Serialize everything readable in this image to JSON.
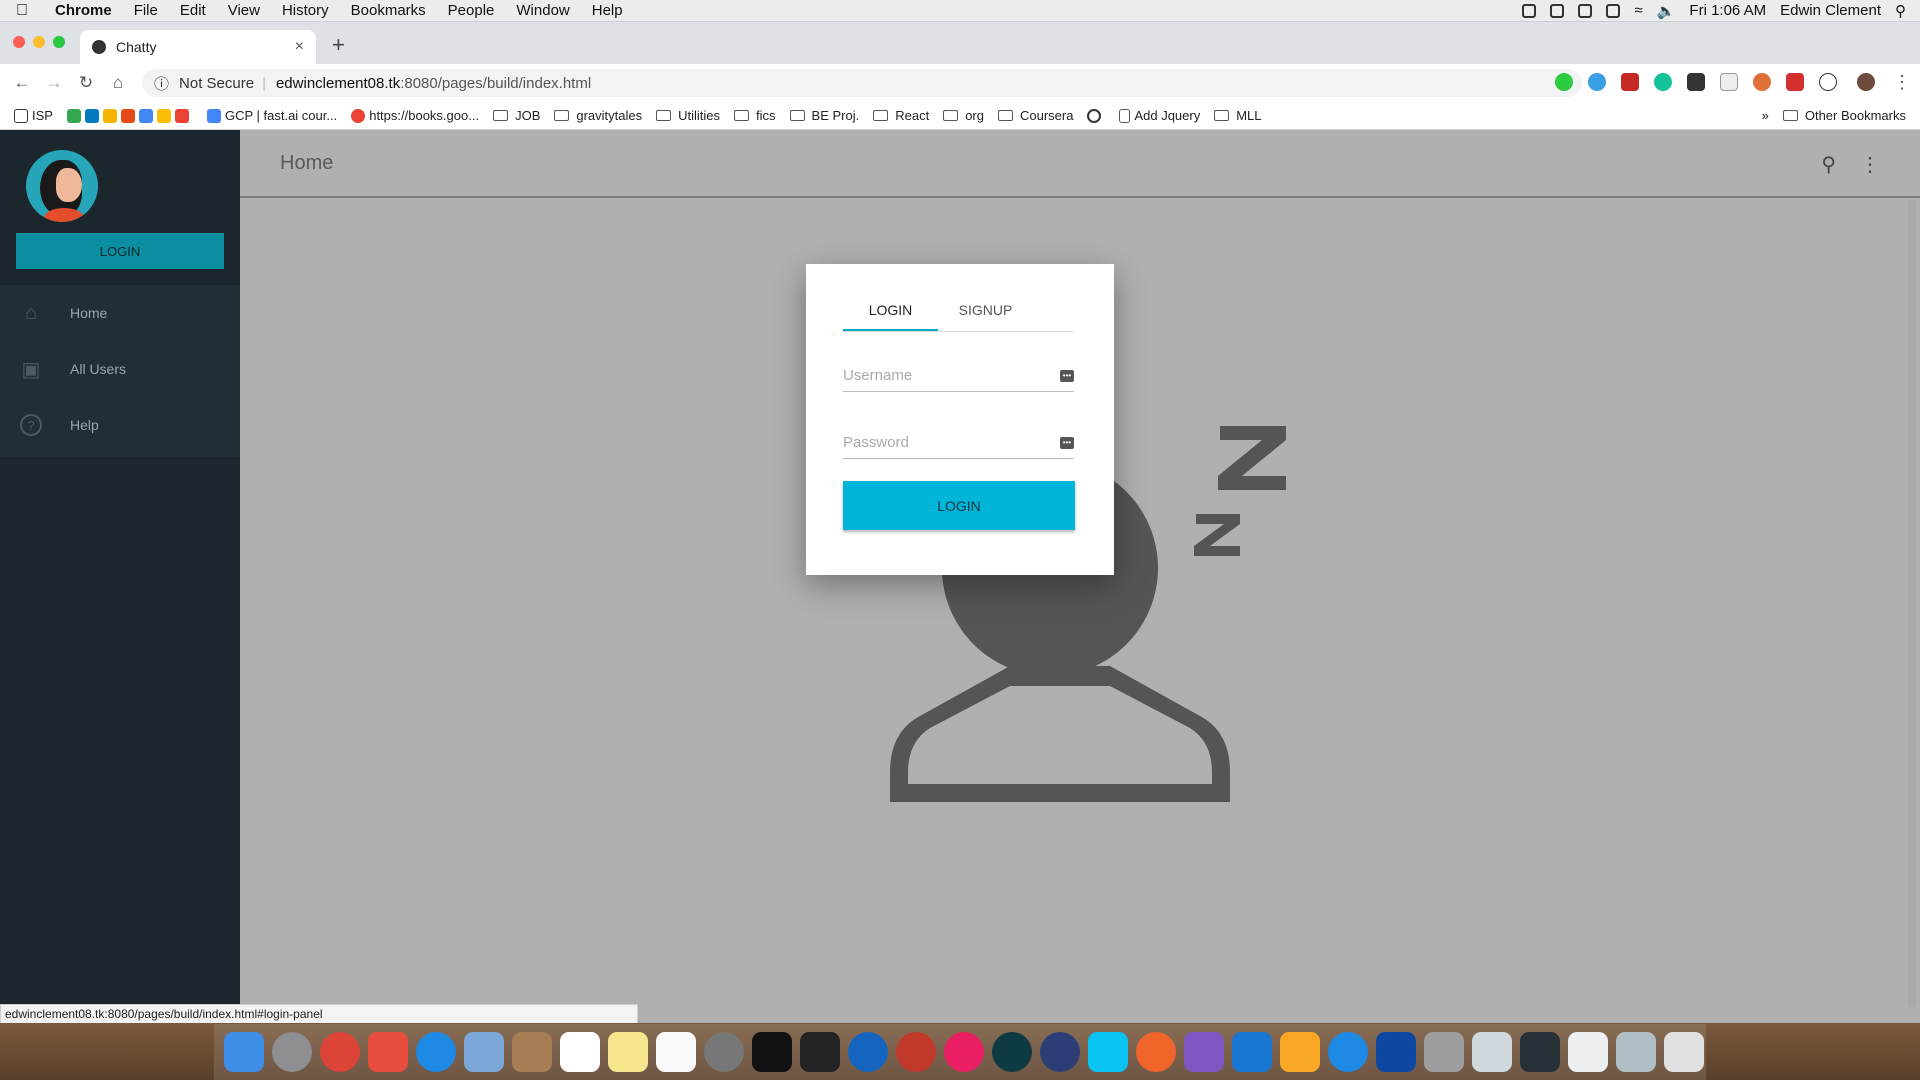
{
  "os_menubar": {
    "app": "Chrome",
    "menus": [
      "File",
      "Edit",
      "View",
      "History",
      "Bookmarks",
      "People",
      "Window",
      "Help"
    ],
    "clock": "Fri 1:06 AM",
    "user": "Edwin Clement"
  },
  "browser": {
    "tab_title": "Chatty",
    "security_label": "Not Secure",
    "url_host": "edwinclement08.tk",
    "url_path": ":8080/pages/build/index.html",
    "bookmarks": [
      "ISP",
      "GCP | fast.ai cour...",
      "https://books.goo...",
      "JOB",
      "gravitytales",
      "Utilities",
      "fics",
      "BE Proj.",
      "React",
      "org",
      "Coursera",
      "Add Jquery",
      "MLL"
    ],
    "other_bookmarks": "Other Bookmarks",
    "status_url": "edwinclement08.tk:8080/pages/build/index.html#login-panel"
  },
  "sidebar": {
    "login_button": "LOGIN",
    "items": [
      {
        "label": "Home",
        "icon": "home-icon"
      },
      {
        "label": "All Users",
        "icon": "inbox-icon"
      },
      {
        "label": "Help",
        "icon": "help-icon"
      }
    ]
  },
  "appbar": {
    "title": "Home"
  },
  "login_modal": {
    "tabs": [
      "LOGIN",
      "SIGNUP"
    ],
    "username_placeholder": "Username",
    "password_placeholder": "Password",
    "submit": "LOGIN"
  },
  "colors": {
    "accent": "#00b5d8",
    "sidebar_bg": "#1c262d",
    "content_bg": "#b0b0b0",
    "sleeping_icon": "#555555"
  }
}
